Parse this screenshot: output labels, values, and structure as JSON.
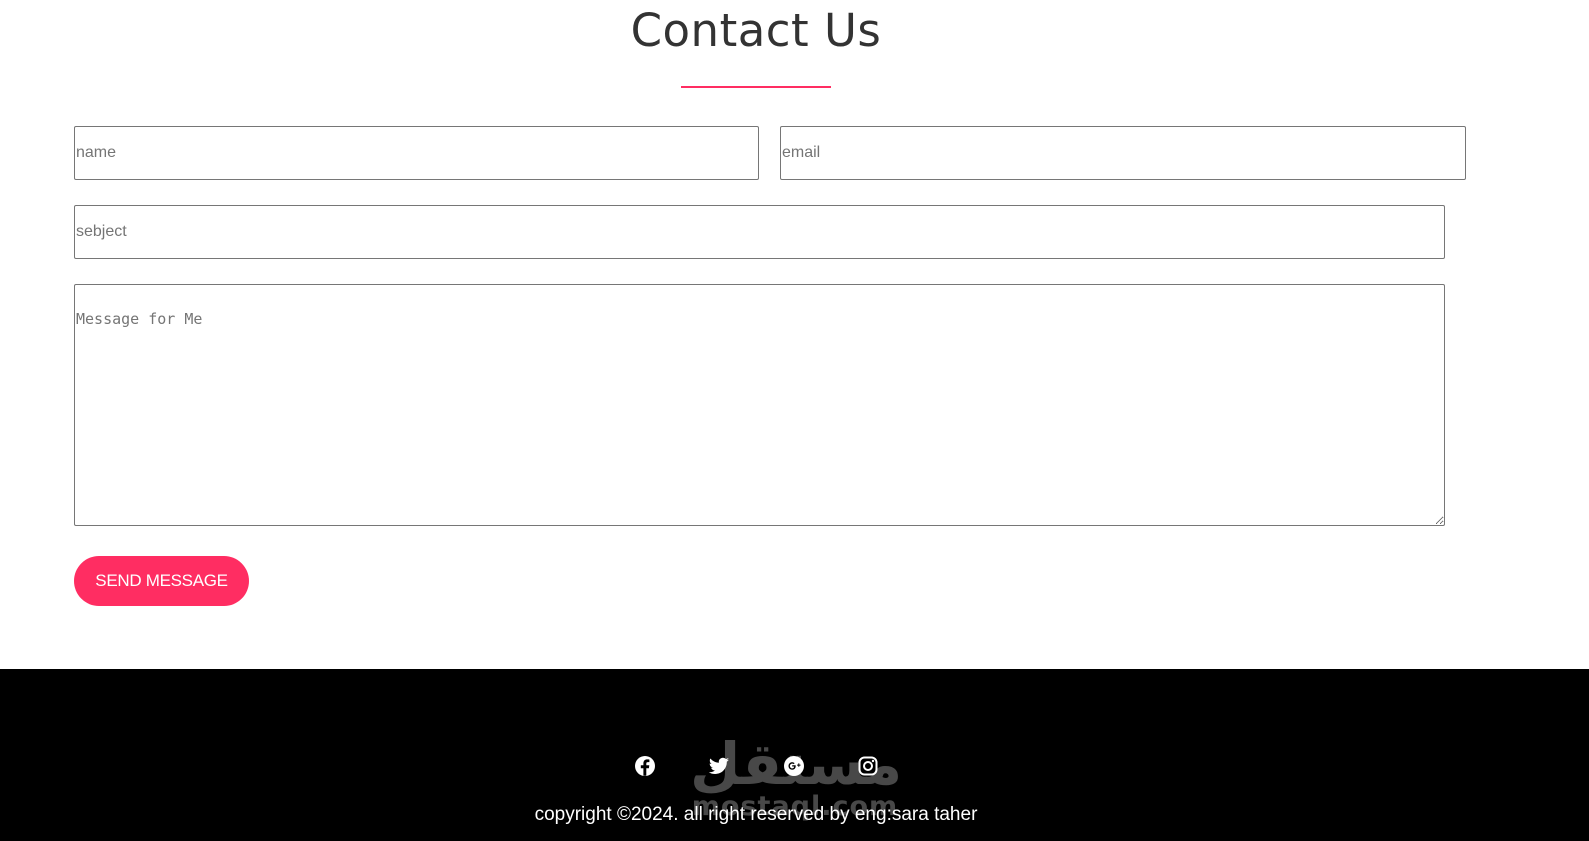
{
  "contact": {
    "title": "Contact Us",
    "name_placeholder": "name",
    "email_placeholder": "email",
    "subject_placeholder": "sebject",
    "message_placeholder": "Message for Me",
    "send_label": "SEND MESSAGE"
  },
  "footer": {
    "social_icons": [
      "facebook-icon",
      "twitter-icon",
      "google-plus-icon",
      "instagram-icon"
    ],
    "copyright": "copyright ©2024. all right reserved by eng:sara taher",
    "watermark": {
      "arabic": "مستقل",
      "latin": "mostaql.com"
    }
  },
  "colors": {
    "accent": "#ff2d62",
    "footer_bg": "#000000",
    "title_text": "#333333",
    "page_bg": "#ffffff"
  }
}
